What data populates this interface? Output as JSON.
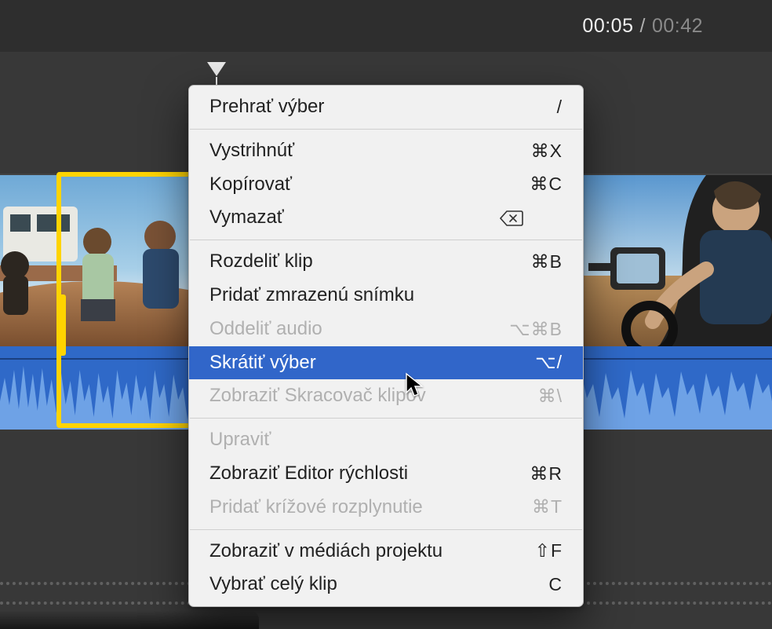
{
  "timecode": {
    "current": "00:05",
    "separator": "/",
    "total": "00:42"
  },
  "menu": {
    "play": {
      "label": "Prehrať výber",
      "shortcut": "/"
    },
    "cut": {
      "label": "Vystrihnúť",
      "shortcut": "⌘X"
    },
    "copy": {
      "label": "Kopírovať",
      "shortcut": "⌘C"
    },
    "delete": {
      "label": "Vymazať",
      "shortcut": ""
    },
    "split": {
      "label": "Rozdeliť klip",
      "shortcut": "⌘B"
    },
    "freeze": {
      "label": "Pridať zmrazenú snímku",
      "shortcut": ""
    },
    "detach": {
      "label": "Oddeliť audio",
      "shortcut": "⌥⌘B"
    },
    "trim": {
      "label": "Skrátiť výber",
      "shortcut": "⌥/"
    },
    "trimmer": {
      "label": "Zobraziť Skracovač klipov",
      "shortcut": "⌘\\"
    },
    "adjust": {
      "label": "Upraviť",
      "shortcut": ""
    },
    "speed": {
      "label": "Zobraziť Editor rýchlosti",
      "shortcut": "⌘R"
    },
    "crossfade": {
      "label": "Pridať krížové rozplynutie",
      "shortcut": "⌘T"
    },
    "reveal": {
      "label": "Zobraziť v médiách projektu",
      "shortcut": "⇧F"
    },
    "selectall": {
      "label": "Vybrať celý klip",
      "shortcut": "C"
    }
  }
}
